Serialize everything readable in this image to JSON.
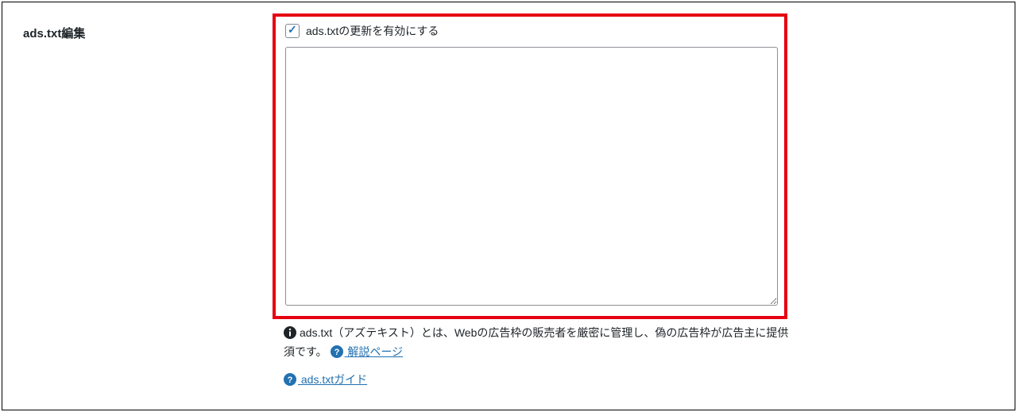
{
  "section": {
    "label": "ads.txt編集"
  },
  "checkbox": {
    "label": "ads.txtの更新を有効にする",
    "checked": true
  },
  "textarea": {
    "value": ""
  },
  "help": {
    "info_text_part1": "ads.txt（アズテキスト）とは、Webの広告枠の販売者を厳密に管理し、偽の広告枠が広告主に提供",
    "info_text_part2": "須です。",
    "explain_link_label": " 解説ページ",
    "guide_link_label": " ads.txtガイド"
  },
  "colors": {
    "highlight_border": "#e60012",
    "link": "#2271b1",
    "icon_dark": "#1d2327"
  }
}
